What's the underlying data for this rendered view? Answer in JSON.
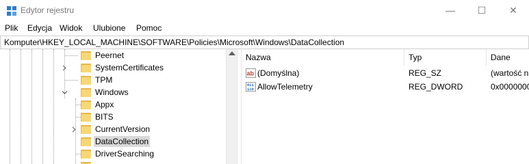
{
  "window": {
    "title": "Edytor rejestru",
    "controls": {
      "minimize": "—",
      "maximize": "☐",
      "close": "✕"
    }
  },
  "menu": [
    "Plik",
    "Edycja",
    "Widok",
    "Ulubione",
    "Pomoc"
  ],
  "address": "Komputer\\HKEY_LOCAL_MACHINE\\SOFTWARE\\Policies\\Microsoft\\Windows\\DataCollection",
  "tree": [
    {
      "label": "Peernet",
      "expander": ""
    },
    {
      "label": "SystemCertificates",
      "expander": ">"
    },
    {
      "label": "TPM",
      "expander": ""
    },
    {
      "label": "Windows",
      "expander": "v"
    },
    {
      "label": "Appx",
      "expander": ""
    },
    {
      "label": "BITS",
      "expander": ""
    },
    {
      "label": "CurrentVersion",
      "expander": ">"
    },
    {
      "label": "DataCollection",
      "expander": "",
      "selected": true
    },
    {
      "label": "DriverSearching",
      "expander": ""
    }
  ],
  "list": {
    "columns": [
      "Nazwa",
      "Typ",
      "Dane"
    ],
    "rows": [
      {
        "icon": "string-value-icon",
        "name": "(Domyślna)",
        "type": "REG_SZ",
        "data": "(wartość n"
      },
      {
        "icon": "dword-value-icon",
        "name": "AllowTelemetry",
        "type": "REG_DWORD",
        "data": "0x0000000"
      }
    ]
  },
  "colors": {
    "folder": "#f8d775",
    "selection": "#d9d9d9"
  }
}
